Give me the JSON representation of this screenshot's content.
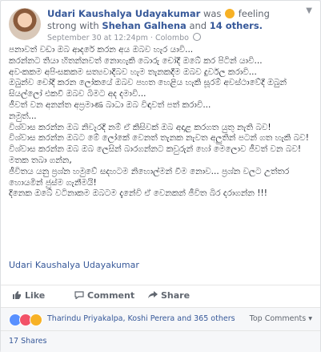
{
  "post": {
    "author": "Udari Kaushalya Udayakumar",
    "status_prefix": "was",
    "feeling": "feeling strong",
    "with": "with",
    "tagged": "Shehan Galhena",
    "and": "and",
    "others": "14 others.",
    "date": "September 30 at 12:24pm",
    "sep": "·",
    "location": "Colombo",
    "body_lines": [
      "පනාවත් වඩා ඔබ ආදරේ කරන අය ඔබව හැර යාවි...",
      "කරන්නට තියා හිතන්නවත් නොහැකි බොරු චෝදී ඔබේ කර පිටින් යාවි...",
      "අවංකකම අපිංසකකම සත්‍යවාදීබව හැම තැනකදීම ඔබව දුර්වල කරාවි...",
      "ඔබුන්ව චෝදී කරන ලෝකයේ ඔබව පහත හෙළිය හැකි සූරම් අවස්ථාවේදී ඔබුන් සියල්ලෝ එකවී ඔබව බිමට අද දමාවි...",
      "ජීවත් වන අනන්ත අප්‍රමාණ බාධා ඔබ විඳාවත් පත් කරාවි...",
      "නමුත්...",
      "විශ්වාස කරන්න ඔබ නිවැරදි නම් ඒ කිසිවක් ඔබ අදාළ කරගත යුතු නැති බව!",
      "විශ්වාස කරන්න ඔබට මේ ලෝකේ වෙනත් තැනක නැවත අලුතින් පටන් ගත හැකි බව!",
      "විශ්වාස කරන්න ඔබ ඔබ ලෙසින් බාරගන්නට කවුරුන් හෝ මෙලොව ජීවත් වන බව!",
      "මතක තබා ගන්න,",
      "ජීවිතය යනු ප්‍රශ්න හමුවේ සදහටම නිහොල්මන් වීම නොව... ප්‍රශ්න වලට උත්තර හොයමින් ජුස්ම ගැනීමයි!",
      "දිනෙක ඔබේ වටිනාකම ඔබටම දැනේවි ඒ වෙනකන් ජීවිත බිර දරාගන්න !!!"
    ],
    "signature": "Udari Kaushalya Udayakumar"
  },
  "actions": {
    "like": "Like",
    "comment": "Comment",
    "share": "Share"
  },
  "reactions": {
    "text": "Tharindu Priyakalpa, Koshi Perera and 365 others",
    "top_comments": "Top Comments ▾"
  },
  "shares": "17 Shares",
  "colors": {
    "link": "#365899",
    "like_blue": "#5890ff",
    "love_red": "#f25268",
    "haha_yellow": "#f7b125"
  }
}
